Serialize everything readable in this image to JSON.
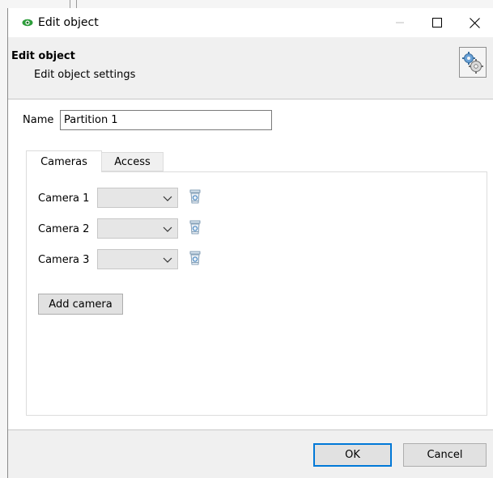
{
  "window": {
    "title": "Edit object"
  },
  "header": {
    "title": "Edit object",
    "subtitle": "Edit object settings"
  },
  "form": {
    "name_label": "Name",
    "name_value": "Partition 1"
  },
  "tabs": [
    {
      "label": "Cameras",
      "active": true
    },
    {
      "label": "Access",
      "active": false
    }
  ],
  "cameras": [
    {
      "label": "Camera 1",
      "value": ""
    },
    {
      "label": "Camera 2",
      "value": ""
    },
    {
      "label": "Camera 3",
      "value": ""
    }
  ],
  "buttons": {
    "add_camera": "Add camera",
    "ok": "OK",
    "cancel": "Cancel"
  },
  "colors": {
    "eye_icon": "#2e9e3c",
    "header_bg": "#f0f0f0",
    "ok_border": "#0078d7"
  },
  "icons": [
    "eye-icon",
    "minimize-icon",
    "maximize-icon",
    "close-icon",
    "gear-settings-icon",
    "chevron-down-icon",
    "recycle-bin-icon"
  ]
}
